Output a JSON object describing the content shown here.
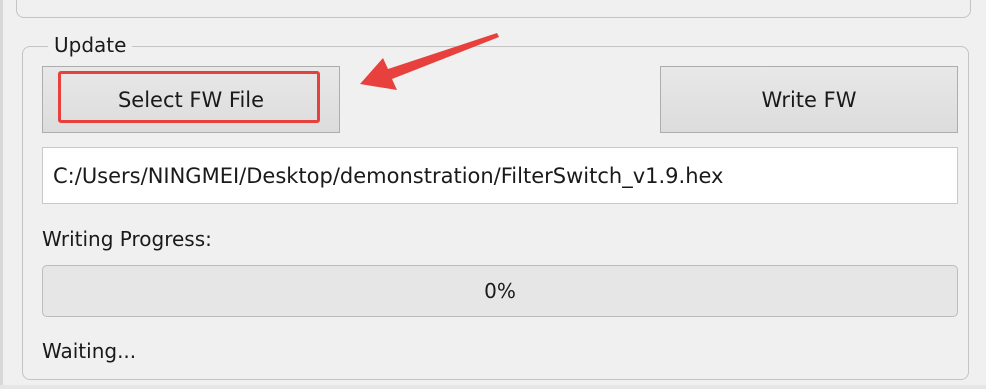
{
  "update_group": {
    "title": "Update",
    "select_fw_label": "Select FW File",
    "write_fw_label": "Write FW",
    "fw_path_value": "C:/Users/NINGMEI/Desktop/demonstration/FilterSwitch_v1.9.hex",
    "progress_label": "Writing Progress:",
    "progress_percent": 0,
    "progress_text": "0%",
    "status_text": "Waiting..."
  },
  "annotation": {
    "color": "#e8403d"
  }
}
